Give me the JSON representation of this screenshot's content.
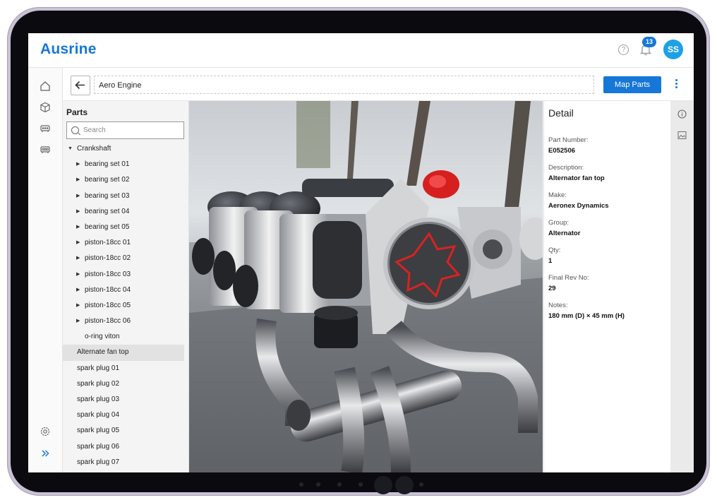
{
  "app": {
    "brand": "Ausrine",
    "notification_count": "13",
    "user_initials": "SS",
    "help_glyph": "?"
  },
  "toolbar": {
    "title": "Aero Engine",
    "map_button": "Map Parts"
  },
  "parts": {
    "heading": "Parts",
    "search_placeholder": "Search",
    "root": "Crankshaft",
    "items": [
      {
        "label": "bearing set 01",
        "expandable": true
      },
      {
        "label": "bearing set 02",
        "expandable": true
      },
      {
        "label": "bearing set 03",
        "expandable": true
      },
      {
        "label": "bearing set 04",
        "expandable": true
      },
      {
        "label": "bearing set 05",
        "expandable": true
      },
      {
        "label": "piston-18cc 01",
        "expandable": true
      },
      {
        "label": "piston-18cc 02",
        "expandable": true
      },
      {
        "label": "piston-18cc 03",
        "expandable": true
      },
      {
        "label": "piston-18cc 04",
        "expandable": true
      },
      {
        "label": "piston-18cc 05",
        "expandable": true
      },
      {
        "label": "piston-18cc 06",
        "expandable": true
      },
      {
        "label": "o-ring viton",
        "expandable": false
      },
      {
        "label": "Alternate fan top",
        "expandable": false,
        "selected": true
      },
      {
        "label": "spark plug 01",
        "expandable": false
      },
      {
        "label": "spark plug 02",
        "expandable": false
      },
      {
        "label": "spark plug 03",
        "expandable": false
      },
      {
        "label": "spark plug 04",
        "expandable": false
      },
      {
        "label": "spark plug 05",
        "expandable": false
      },
      {
        "label": "spark plug 06",
        "expandable": false
      },
      {
        "label": "spark plug 07",
        "expandable": false
      }
    ]
  },
  "detail": {
    "heading": "Detail",
    "fields": [
      {
        "label": "Part Number:",
        "value": "E052506"
      },
      {
        "label": "Description:",
        "value": "Alternator fan top"
      },
      {
        "label": "Make:",
        "value": "Aeronex Dynamics"
      },
      {
        "label": "Group:",
        "value": "Alternator"
      },
      {
        "label": "Qty:",
        "value": "1"
      },
      {
        "label": "Final Rev No:",
        "value": "29"
      },
      {
        "label": "Notes:",
        "value": "180 mm (D) × 45 mm (H)"
      }
    ]
  },
  "icons": {
    "rail": [
      "home-icon",
      "cube-icon",
      "assembly-icon",
      "assembly-alt-icon",
      "settings-icon",
      "expand-icon"
    ],
    "detail_tools": [
      "info-icon",
      "image-icon"
    ]
  },
  "colors": {
    "accent": "#1677d8",
    "avatar": "#1ea0e6",
    "highlight_part": "#d61f1f"
  }
}
